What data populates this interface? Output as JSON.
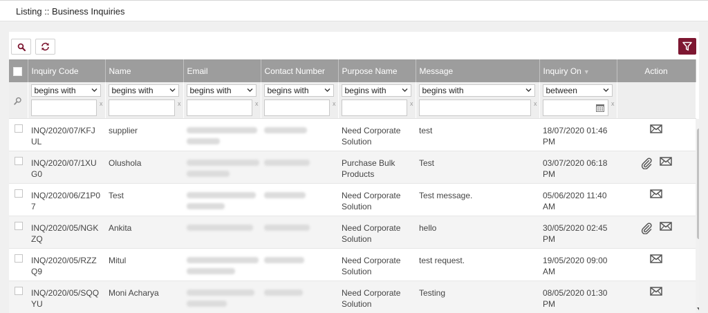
{
  "page": {
    "title": "Listing :: Business Inquiries"
  },
  "colors": {
    "accent": "#7d1731",
    "header_bg": "#9d9d9d",
    "icon": "#555555"
  },
  "toolbar": {
    "search_icon": "search-icon",
    "refresh_icon": "refresh-icon",
    "filter_icon": "filter-icon"
  },
  "columns": [
    {
      "label": "Inquiry Code"
    },
    {
      "label": "Name"
    },
    {
      "label": "Email"
    },
    {
      "label": "Contact Number"
    },
    {
      "label": "Purpose Name"
    },
    {
      "label": "Message"
    },
    {
      "label": "Inquiry On"
    },
    {
      "label": "Action"
    }
  ],
  "filters": [
    {
      "operator": "begins with",
      "value": "",
      "clear": "x"
    },
    {
      "operator": "begins with",
      "value": "",
      "clear": "x"
    },
    {
      "operator": "begins with",
      "value": "",
      "clear": "x"
    },
    {
      "operator": "begins with",
      "value": "",
      "clear": "x"
    },
    {
      "operator": "begins with",
      "value": "",
      "clear": "x"
    },
    {
      "operator": "begins with",
      "value": "",
      "clear": "x"
    },
    {
      "operator": "between",
      "value": "",
      "clear": "x"
    }
  ],
  "rows": [
    {
      "code": "INQ/2020/07/KFJUL",
      "name": "supplier",
      "purpose": "Need Corporate Solution",
      "message": "test",
      "date": "18/07/2020 01:46 PM",
      "has_attachment": false
    },
    {
      "code": "INQ/2020/07/1XUG0",
      "name": "Olushola",
      "purpose": "Purchase Bulk Products",
      "message": "Test",
      "date": "03/07/2020 06:18 PM",
      "has_attachment": true
    },
    {
      "code": "INQ/2020/06/Z1P07",
      "name": "Test",
      "purpose": "Need Corporate Solution",
      "message": "Test message.",
      "date": "05/06/2020 11:40 AM",
      "has_attachment": false
    },
    {
      "code": "INQ/2020/05/NGKZQ",
      "name": "Ankita",
      "purpose": "Need Corporate Solution",
      "message": "hello",
      "date": "30/05/2020 02:45 PM",
      "has_attachment": true
    },
    {
      "code": "INQ/2020/05/RZZQ9",
      "name": "Mitul",
      "purpose": "Need Corporate Solution",
      "message": "test request.",
      "date": "19/05/2020 09:00 AM",
      "has_attachment": false
    },
    {
      "code": "INQ/2020/05/SQQYU",
      "name": "Moni Acharya",
      "purpose": "Need Corporate Solution",
      "message": "Testing",
      "date": "08/05/2020 01:30 PM",
      "has_attachment": false
    }
  ]
}
